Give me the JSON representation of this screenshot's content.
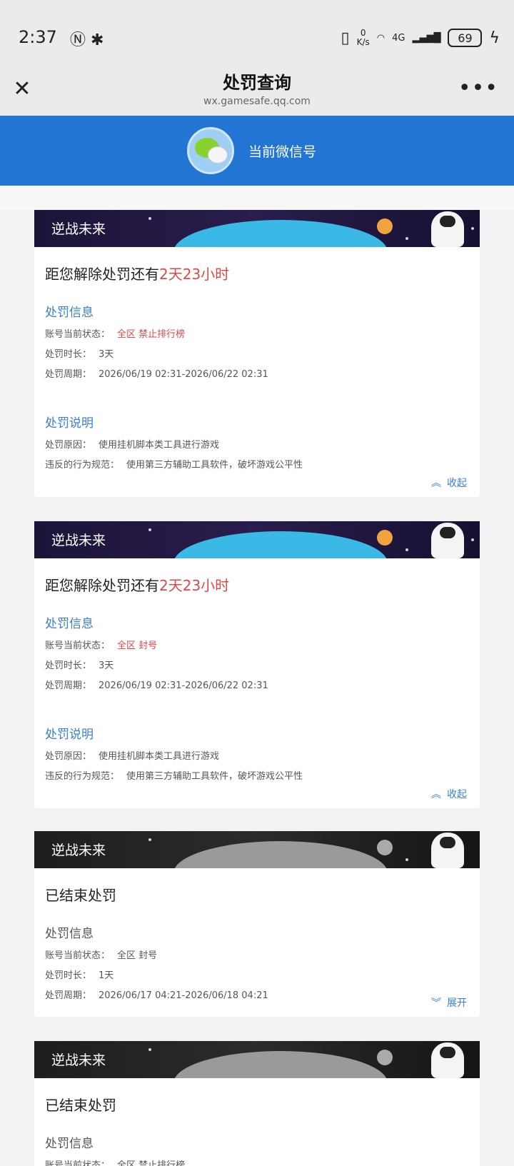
{
  "status_bar": {
    "time": "2:37",
    "speed_top": "0",
    "speed_bottom": "K/s",
    "network": "4G",
    "battery": "69"
  },
  "nav": {
    "title": "处罚查询",
    "subtitle": "wx.gamesafe.qq.com",
    "close_icon": "close-icon",
    "more_icon": "more-icon"
  },
  "account": {
    "label": "当前微信号"
  },
  "cards": [
    {
      "banner_text": "逆战未来",
      "countdown_prefix": "距您解除处罚还有",
      "countdown_value": "2天23小时",
      "info_title": "处罚信息",
      "status_label": "账号当前状态：",
      "status_value": "全区 禁止排行榜",
      "duration_label": "处罚时长：",
      "duration_value": "3天",
      "period_label": "处罚周期：",
      "period_value": "2026/06/19 02:31-2026/06/22 02:31",
      "desc_title": "处罚说明",
      "reason_label": "处罚原因：",
      "reason_value": "使用挂机脚本类工具进行游戏",
      "rule_label": "违反的行为规范：",
      "rule_value": "使用第三方辅助工具软件，破坏游戏公平性",
      "toggle": "收起"
    },
    {
      "banner_text": "逆战未来",
      "countdown_prefix": "距您解除处罚还有",
      "countdown_value": "2天23小时",
      "info_title": "处罚信息",
      "status_label": "账号当前状态：",
      "status_value": "全区 封号",
      "duration_label": "处罚时长：",
      "duration_value": "3天",
      "period_label": "处罚周期：",
      "period_value": "2026/06/19 02:31-2026/06/22 02:31",
      "desc_title": "处罚说明",
      "reason_label": "处罚原因：",
      "reason_value": "使用挂机脚本类工具进行游戏",
      "rule_label": "违反的行为规范：",
      "rule_value": "使用第三方辅助工具软件，破坏游戏公平性",
      "toggle": "收起"
    },
    {
      "banner_text": "逆战未来",
      "ended_title": "已结束处罚",
      "info_title": "处罚信息",
      "status_label": "账号当前状态：",
      "status_value": "全区 封号",
      "duration_label": "处罚时长：",
      "duration_value": "1天",
      "period_label": "处罚周期：",
      "period_value": "2026/06/17 04:21-2026/06/18 04:21",
      "toggle": "展开"
    },
    {
      "banner_text": "逆战未来",
      "ended_title": "已结束处罚",
      "info_title": "处罚信息",
      "status_label": "账号当前状态：",
      "status_value": "全区 禁止排行榜"
    }
  ]
}
